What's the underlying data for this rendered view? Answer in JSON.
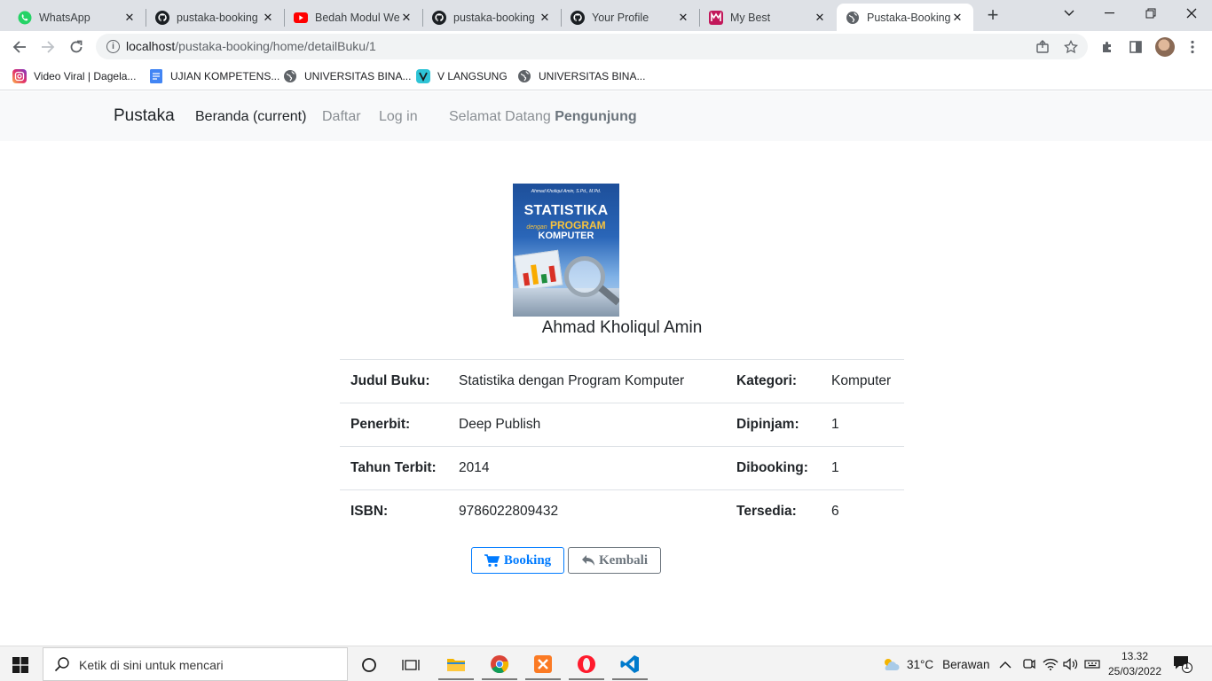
{
  "browser": {
    "tabs": [
      {
        "title": "WhatsApp",
        "icon": "whatsapp-icon",
        "active": false
      },
      {
        "title": "pustaka-booking",
        "icon": "github-icon",
        "active": false
      },
      {
        "title": "Bedah Modul We",
        "icon": "youtube-icon",
        "active": false
      },
      {
        "title": "pustaka-booking",
        "icon": "github-icon",
        "active": false
      },
      {
        "title": "Your Profile",
        "icon": "github-icon",
        "active": false
      },
      {
        "title": "My Best",
        "icon": "m-logo-icon",
        "active": false
      },
      {
        "title": "Pustaka-Booking",
        "icon": "globe-icon",
        "active": true
      }
    ],
    "url_host": "localhost",
    "url_path": "/pustaka-booking/home/detailBuku/1",
    "bookmarks": [
      {
        "label": "Video Viral | Dagela...",
        "icon": "instagram-icon"
      },
      {
        "label": "UJIAN KOMPETENS...",
        "icon": "docs-icon"
      },
      {
        "label": "UNIVERSITAS BINA...",
        "icon": "globe-icon"
      },
      {
        "label": "V LANGSUNG",
        "icon": "v-icon"
      },
      {
        "label": "UNIVERSITAS BINA...",
        "icon": "globe-icon"
      }
    ]
  },
  "navbar": {
    "brand": "Pustaka",
    "links": [
      {
        "label": "Beranda (current)",
        "active": true
      },
      {
        "label": "Daftar",
        "active": false
      },
      {
        "label": "Log in",
        "active": false
      }
    ],
    "welcome_prefix": "Selamat Datang",
    "welcome_user": "Pengunjung"
  },
  "book": {
    "cover": {
      "author_small": "Ahmad Kholiqul Amin, S.Pd., M.Pd.",
      "title_line1": "STATISTIKA",
      "title_connector": "dengan",
      "title_line2": "PROGRAM",
      "title_line3": "KOMPUTER"
    },
    "author": "Ahmad Kholiqul Amin",
    "rows": [
      {
        "label1": "Judul Buku:",
        "value1": "Statistika dengan Program Komputer",
        "label2": "Kategori:",
        "value2": "Komputer"
      },
      {
        "label1": "Penerbit:",
        "value1": "Deep Publish",
        "label2": "Dipinjam:",
        "value2": "1"
      },
      {
        "label1": "Tahun Terbit:",
        "value1": "2014",
        "label2": "Dibooking:",
        "value2": "1"
      },
      {
        "label1": "ISBN:",
        "value1": "9786022809432",
        "label2": "Tersedia:",
        "value2": "6"
      }
    ],
    "booking_label": "Booking",
    "back_label": "Kembali"
  },
  "taskbar": {
    "search_placeholder": "Ketik di sini untuk mencari",
    "weather_temp": "31°C",
    "weather_text": "Berawan",
    "time": "13.32",
    "date": "25/03/2022",
    "notification_count": "1"
  },
  "colors": {
    "primary": "#007bff",
    "secondary": "#6c757d",
    "navbar_bg": "#f8f9fa"
  }
}
